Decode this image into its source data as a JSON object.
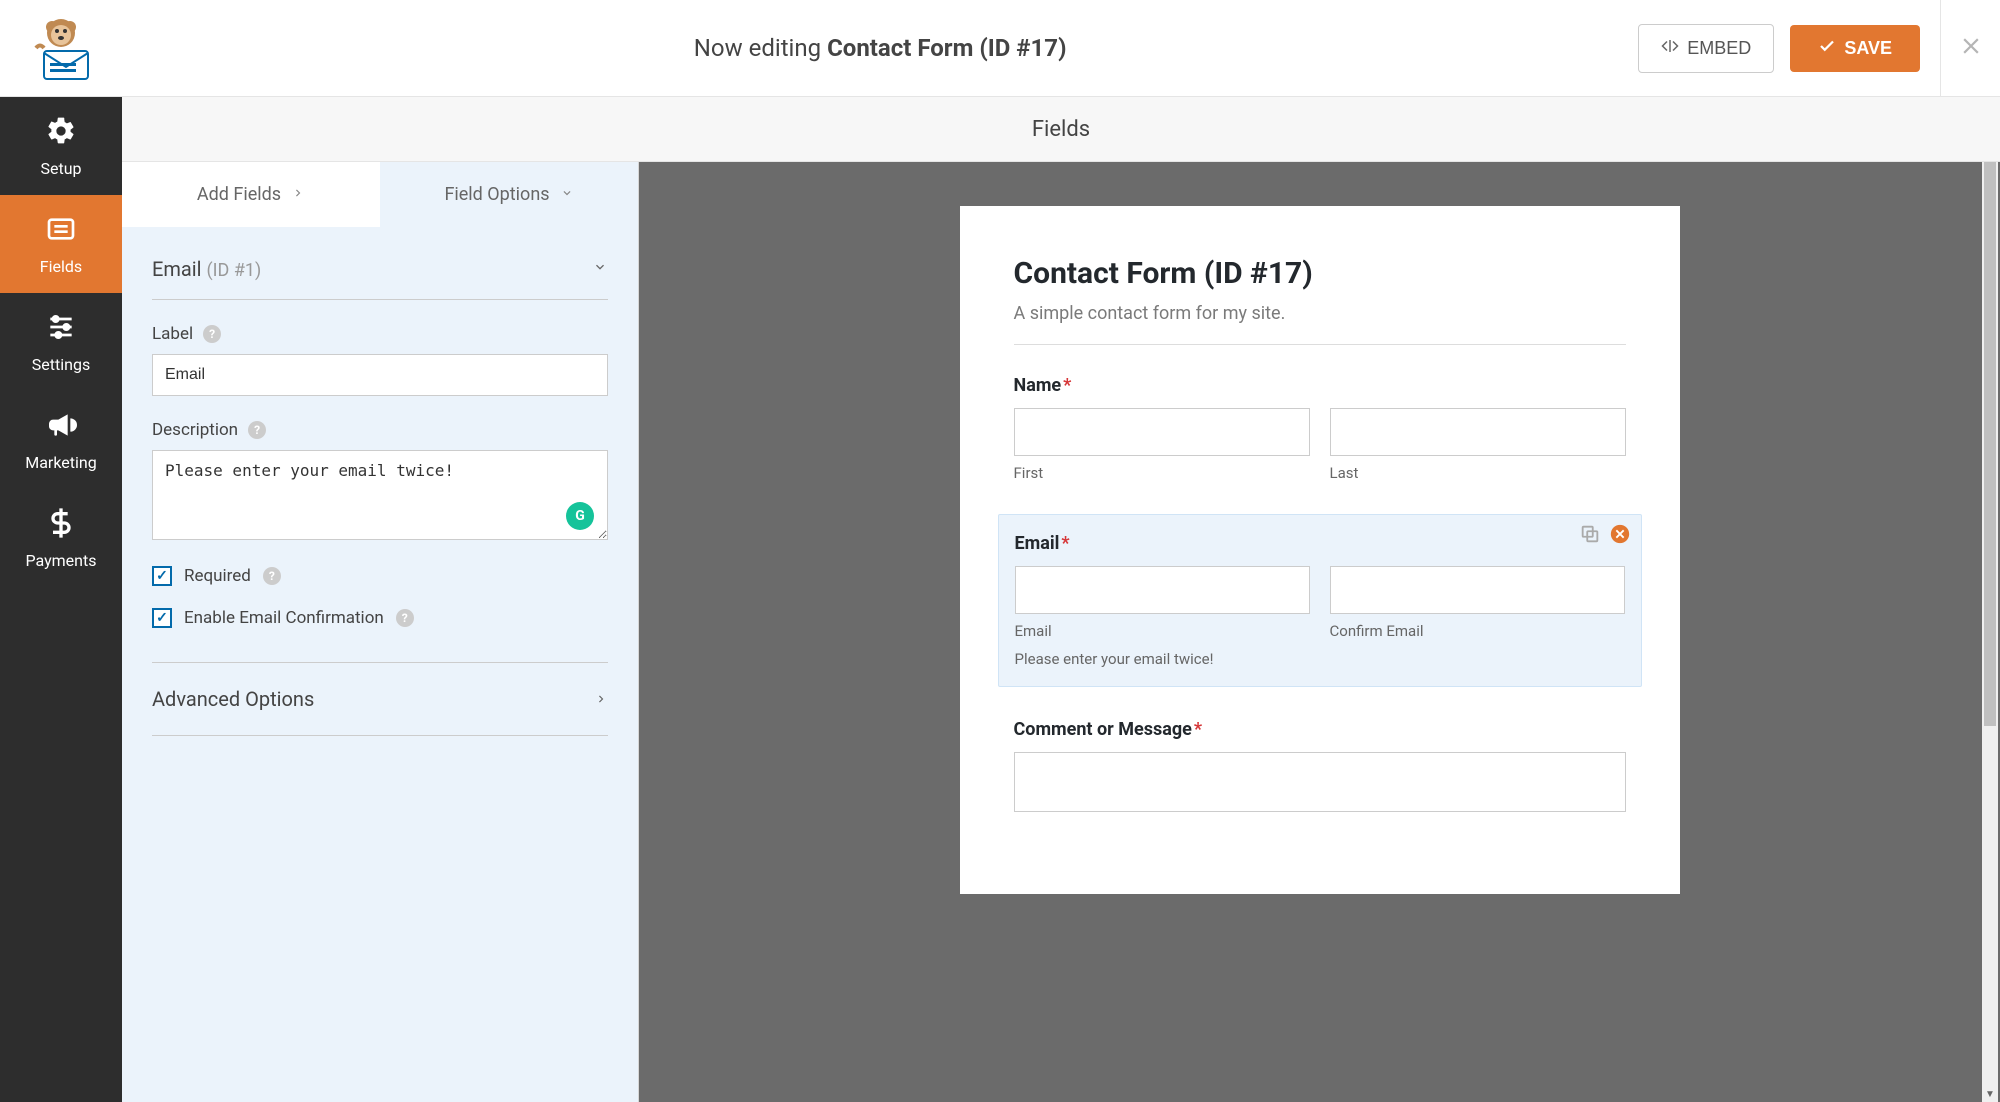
{
  "topbar": {
    "editing_prefix": "Now editing ",
    "form_name": "Contact Form (ID #17)",
    "embed_label": "EMBED",
    "save_label": "SAVE"
  },
  "sidebar": {
    "items": [
      {
        "label": "Setup"
      },
      {
        "label": "Fields"
      },
      {
        "label": "Settings"
      },
      {
        "label": "Marketing"
      },
      {
        "label": "Payments"
      }
    ]
  },
  "tabbar": {
    "title": "Fields"
  },
  "panel_tabs": {
    "add": "Add Fields",
    "options": "Field Options"
  },
  "field": {
    "name": "Email",
    "id_hint": "(ID #1)",
    "label_caption": "Label",
    "label_value": "Email",
    "description_caption": "Description",
    "description_value": "Please enter your email twice!",
    "required_label": "Required",
    "confirm_label": "Enable Email Confirmation",
    "advanced_label": "Advanced Options"
  },
  "preview": {
    "title": "Contact Form (ID #17)",
    "description": "A simple contact form for my site.",
    "name_label": "Name",
    "first_sub": "First",
    "last_sub": "Last",
    "email_label": "Email",
    "email_sub": "Email",
    "confirm_sub": "Confirm Email",
    "email_desc": "Please enter your email twice!",
    "message_label": "Comment or Message"
  }
}
